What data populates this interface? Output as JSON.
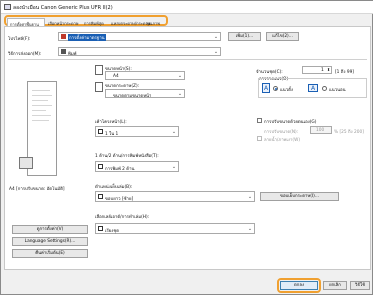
{
  "window": {
    "title": "ลองนำเมือน Canon Generic Plus UFR II(2)"
  },
  "tabs": [
    {
      "label": "การตั้งค่าพื้นฐาน"
    },
    {
      "label": "เลือกหน้ากระดาษ"
    },
    {
      "label": "การพิมพ์สุด"
    },
    {
      "label": "แหล่งกระดาษ/กระดาษ"
    },
    {
      "label": "คุณภาพ"
    }
  ],
  "top": {
    "profile_label": "โปรไฟล์(F):",
    "profile_value": "การตั้งค่ามาตรฐาน",
    "add_button": "เพิ่ม(1)...",
    "edit_button": "แก้ไข(2)...",
    "output_label": "วิธีการส่งออก(M):",
    "output_value": "พิมพ์"
  },
  "page_size": {
    "label": "ขนาดหน้า(S):",
    "value": "A4",
    "output_label": "ขนาดกระดาษ(Z):",
    "output_value": "ขนาดตามขนาดหน้า"
  },
  "copies": {
    "label": "จำนวนชุด(C):",
    "value": "1",
    "range": "[1 ถึง 99]",
    "orientation_label": "การวางแนว(O)",
    "portrait": "แนวตั้ง",
    "landscape": "แนวนอน"
  },
  "layout": {
    "label": "เค้าโครงหน้า(L):",
    "value": "1 ใน 1"
  },
  "scaling": {
    "manual_label": "การปรับขนาดด้วยตนเอง(G)",
    "ratio_label": "การปรับขนาด(N):",
    "ratio_value": "100",
    "ratio_range": "% [25 ถึง 200]",
    "watermark_label": "ลายน้ำ/ภาพเงา(W)"
  },
  "duplex": {
    "label": "1 ด้าน/2 ด้าน/การพิมพ์หนังสือ(T):",
    "value": "การพิมพ์ 2 ด้าน"
  },
  "binding": {
    "label": "ตำแหน่งเย็บเล่ม(B):",
    "value": "ขอบยาว [ซ้าย]",
    "margin_button": "ขอบเย็บกระดาษ(I)..."
  },
  "finishing": {
    "label": "เลือกเลย์เอาต์/การทำเล่ม(H):",
    "value": "เรียงชุด"
  },
  "preview": {
    "caption": "A4 [การปรับขนาด: อัตโนมัติ]"
  },
  "left_buttons": [
    {
      "label": "ดูการตั้งค่า(V)"
    },
    {
      "label": "Language Settings(R)..."
    },
    {
      "label": "คืนค่าเริ่มต้น(E)"
    }
  ],
  "footer": {
    "ok": "ตกลง",
    "cancel": "ยกเลิก",
    "help": "วิธีใช้"
  },
  "colors": {
    "highlight": "#f0a030",
    "accent": "#1a5fb4"
  }
}
